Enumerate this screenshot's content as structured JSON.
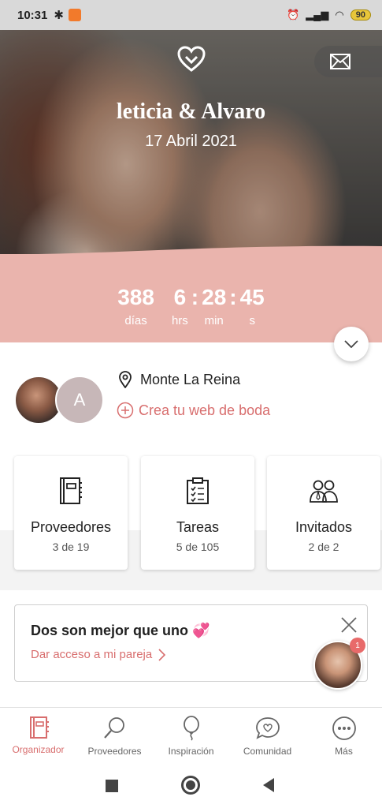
{
  "status_bar": {
    "time": "10:31",
    "battery": "90"
  },
  "hero": {
    "names": "leticia & Alvaro",
    "date": "17 Abril 2021"
  },
  "countdown": {
    "days": "388",
    "days_label": "días",
    "hours": "6",
    "hours_label": "hrs",
    "minutes": "28",
    "minutes_label": "min",
    "seconds": "45",
    "seconds_label": "s",
    "separator": ":"
  },
  "profile": {
    "partner_initial": "A",
    "location": "Monte La Reina",
    "web_link": "Crea tu web de boda"
  },
  "cards": [
    {
      "title": "Proveedores",
      "sub": "3 de 19",
      "icon": "notebook-icon"
    },
    {
      "title": "Tareas",
      "sub": "5 de 105",
      "icon": "clipboard-icon"
    },
    {
      "title": "Invitados",
      "sub": "2 de 2",
      "icon": "guests-icon"
    }
  ],
  "promo": {
    "title": "Dos son mejor que uno",
    "emoji": "💞",
    "link": "Dar acceso a mi pareja",
    "assistant_badge": "1"
  },
  "tabbar": [
    {
      "label": "Organizador",
      "icon": "organizer-icon",
      "active": true
    },
    {
      "label": "Proveedores",
      "icon": "magnifier-icon",
      "active": false
    },
    {
      "label": "Inspiración",
      "icon": "balloon-icon",
      "active": false
    },
    {
      "label": "Comunidad",
      "icon": "chat-heart-icon",
      "active": false
    },
    {
      "label": "Más",
      "icon": "more-icon",
      "active": false
    }
  ],
  "colors": {
    "accent": "#d86e6e",
    "countdown_bg": "#eab4ad"
  }
}
